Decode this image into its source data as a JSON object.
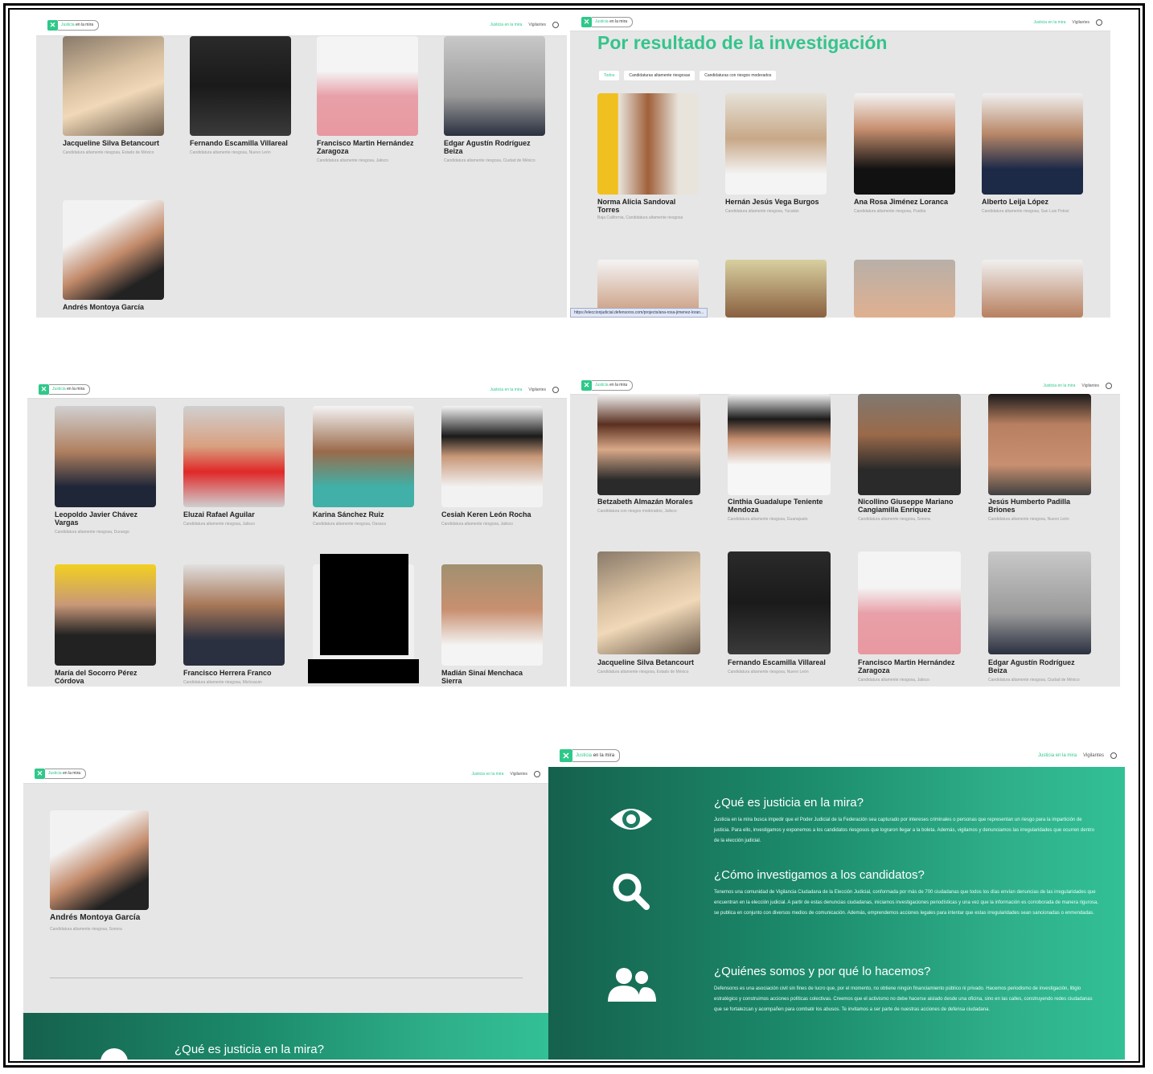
{
  "header": {
    "logo_text_green": "Justicia",
    "logo_text": "en la mira",
    "nav_link": "Justicia en la mira",
    "nav_vigilantes": "Vigilantes"
  },
  "panel1": {
    "cards": [
      {
        "name": "Jacqueline Silva Betancourt",
        "sub": "Candidatura altamente riesgosa, Estado de México"
      },
      {
        "name": "Fernando Escamilla Villareal",
        "sub": "Candidatura altamente riesgosa, Nuevo León"
      },
      {
        "name": "Francisco Martin Hernández Zaragoza",
        "sub": "Candidatura altamente riesgosa, Jalisco"
      },
      {
        "name": "Edgar Agustín Rodríguez Beiza",
        "sub": "Candidatura altamente riesgosa, Ciudad de México"
      },
      {
        "name": "Andrés Montoya García",
        "sub": ""
      }
    ]
  },
  "panel2": {
    "heading": "Por resultado de la investigación",
    "tabs": [
      "Todos",
      "Candidaturas altamente riesgosas",
      "Candidaturas con riesgos moderados"
    ],
    "cards": [
      {
        "name": "Norma Alicia Sandoval Torres",
        "sub": "Baja California, Candidatura altamente riesgosa"
      },
      {
        "name": "Hernán Jesús Vega Burgos",
        "sub": "Candidatura altamente riesgosa, Yucatán"
      },
      {
        "name": "Ana Rosa Jiménez Loranca",
        "sub": "Candidatura altamente riesgosa, Puebla"
      },
      {
        "name": "Alberto Leija López",
        "sub": "Candidatura altamente riesgosa, San Luis Potosí"
      }
    ],
    "status_url": "https://eleccionjudicial.defensorxs.com/projects/ana-rosa-jimenez-loran..."
  },
  "panel3": {
    "cards": [
      {
        "name": "Leopoldo Javier Chávez Vargas",
        "sub": "Candidatura altamente riesgosa, Durango"
      },
      {
        "name": "Eluzai Rafael Aguilar",
        "sub": "Candidatura altamente riesgosa, Jalisco"
      },
      {
        "name": "Karina Sánchez Ruiz",
        "sub": "Candidatura altamente riesgosa, Oaxaca"
      },
      {
        "name": "Cesiah Keren León Rocha",
        "sub": "Candidatura altamente riesgosa, Jalisco"
      },
      {
        "name": "María del Socorro Pérez Córdova",
        "sub": ""
      },
      {
        "name": "Francisco Herrera Franco",
        "sub": "Candidatura altamente riesgosa, Michoacán"
      },
      {
        "name": "",
        "sub": ""
      },
      {
        "name": "Madián Sinaí Menchaca Sierra",
        "sub": ""
      }
    ]
  },
  "panel4": {
    "cards": [
      {
        "name": "Betzabeth Almazán Morales",
        "sub": "Candidatura con riesgos moderados, Jalisco"
      },
      {
        "name": "Cinthia Guadalupe Teniente Mendoza",
        "sub": "Candidatura altamente riesgosa, Guanajuato"
      },
      {
        "name": "Nicollino Giuseppe Mariano Cangiamilla Enríquez",
        "sub": "Candidatura altamente riesgosa, Sonora"
      },
      {
        "name": "Jesús Humberto Padilla Briones",
        "sub": "Candidatura altamente riesgosa, Nuevo León"
      },
      {
        "name": "Jacqueline Silva Betancourt",
        "sub": "Candidatura altamente riesgosa, Estado de México"
      },
      {
        "name": "Fernando Escamilla Villareal",
        "sub": "Candidatura altamente riesgosa, Nuevo León"
      },
      {
        "name": "Francisco Martin Hernández Zaragoza",
        "sub": "Candidatura altamente riesgosa, Jalisco"
      },
      {
        "name": "Edgar Agustín Rodríguez Beiza",
        "sub": "Candidatura altamente riesgosa, Ciudad de México"
      }
    ]
  },
  "panel5": {
    "name": "Andrés Montoya García",
    "sub": "Candidatura altamente riesgosa, Sonora",
    "banner_heading": "¿Qué es justicia en la mira?"
  },
  "panel6": {
    "sections": [
      {
        "icon": "eye-icon",
        "heading": "¿Qué es justicia en la mira?",
        "text": "Justicia en la mira busca impedir que el Poder Judicial de la Federación sea capturado por intereses criminales o personas que representan un riesgo para la impartición de justicia. Para ello, investigamos y exponemos a los candidatos riesgosos que lograron llegar a la boleta. Además, vigilamos y denunciamos las irregularidades que ocurren dentro de la elección judicial."
      },
      {
        "icon": "search-icon",
        "heading": "¿Cómo investigamos a los candidatos?",
        "text": "Tenemos una comunidad de Vigilancia Ciudadana de la Elección Judicial, conformada por más de 700 ciudadanas que todos los días envían denuncias de las irregularidades que encuentran en la elección judicial. A partir de estas denuncias ciudadanas, iniciamos investigaciones periodísticas y una vez que la información es corroborada de manera rigurosa, se publica en conjunto con diversos medios de comunicación. Además, emprendemos acciones legales para intentar que estas irregularidades sean sancionadas o enmendadas."
      },
      {
        "icon": "users-icon",
        "heading": "¿Quiénes somos y por qué lo hacemos?",
        "text": "Defensorxs es una asociación civil sin fines de lucro que, por el momento, no obtiene ningún financiamiento público ni privado. Hacemos periodismo de investigación, litigio estratégico y construimos acciones políticas colectivas. Creemos que el activismo no debe hacerse aislado desde una oficina, sino en las calles, construyendo redes ciudadanas que se fortalezcan y acompañen para combatir los abusos. Te invitamos a ser parte de nuestras acciones de defensa ciudadana."
      }
    ]
  },
  "colors": {
    "accent": "#35c48c",
    "panel_bg": "#e6e6e6",
    "teal": "#1c8c6c"
  }
}
